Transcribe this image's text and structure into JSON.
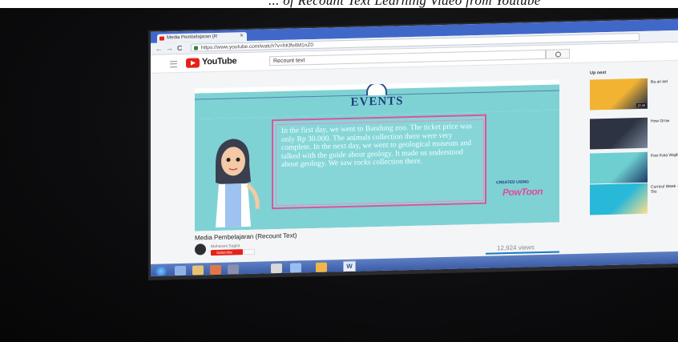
{
  "caption": {
    "text": "... of Recount Text Learning Video from Youtube"
  },
  "browser": {
    "tab_title": "Media Pembelajaran (R",
    "tab_close": "✕",
    "url": "https://www.youtube.com/watch?v=hKlfv4M1nZ0",
    "back": "←",
    "forward": "→",
    "reload": "C"
  },
  "youtube": {
    "logo_text": "YouTube",
    "search_value": "Recount text"
  },
  "video": {
    "section_title": "EVENTS",
    "story": "In the first day, we went to Bandung zoo. The ticket price was only Rp 30.000. The animals collection there were very complete. In the next day, we went to geological museum and talked with the guide about geology. It made us understood about geology. We saw rocks collection there.",
    "watermark_small": "CREATED USING",
    "watermark_big": "PowToon"
  },
  "below_video": {
    "title": "Media Pembelajaran (Recount Text)",
    "channel": "Maharani Sagita",
    "subscribe": "Subscribe",
    "views": "12,924 views"
  },
  "sidebar": {
    "heading": "Up next",
    "items": [
      {
        "meta": "Ba an kel",
        "duration": "12:46",
        "colors": [
          "#f2b333",
          "#1c2a4a"
        ]
      },
      {
        "meta": "How Grow",
        "duration": "",
        "colors": [
          "#2d3342",
          "#7a8799"
        ]
      },
      {
        "meta": "Kiss Kata Wajib",
        "duration": "",
        "colors": [
          "#6ecfd1",
          "#193a66"
        ]
      },
      {
        "meta": "Curricul Week - Stu",
        "duration": "",
        "colors": [
          "#28b8d8",
          "#ffe08a"
        ]
      }
    ]
  },
  "taskbar": {
    "word_label": "W"
  }
}
